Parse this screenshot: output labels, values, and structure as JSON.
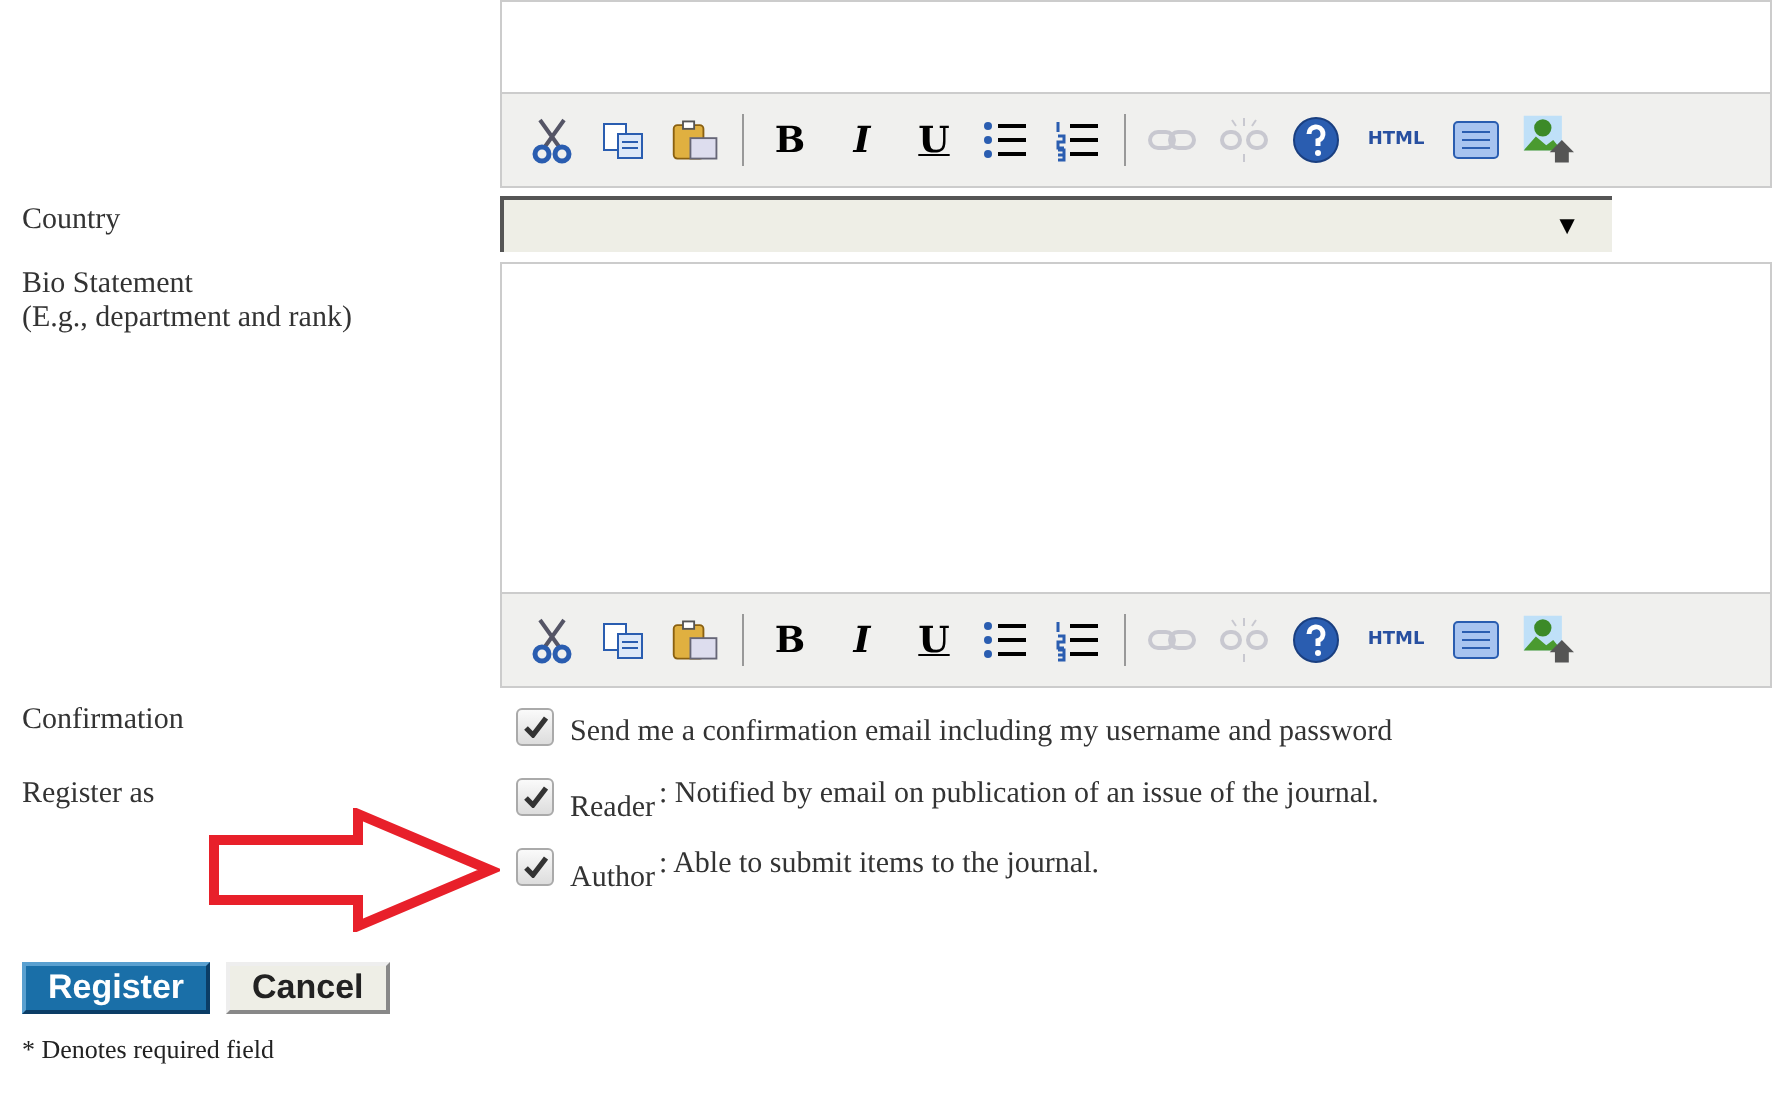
{
  "top_editor": {
    "toolbar": [
      {
        "kind": "cut"
      },
      {
        "kind": "copy"
      },
      {
        "kind": "paste"
      },
      {
        "kind": "separator"
      },
      {
        "kind": "text",
        "label": "B"
      },
      {
        "kind": "text",
        "label": "I"
      },
      {
        "kind": "text",
        "label": "U"
      },
      {
        "kind": "bullets"
      },
      {
        "kind": "numbers"
      },
      {
        "kind": "separator"
      },
      {
        "kind": "link",
        "disabled": true
      },
      {
        "kind": "unlink",
        "disabled": true
      },
      {
        "kind": "help"
      },
      {
        "kind": "text",
        "label": "HTML"
      },
      {
        "kind": "fullscreen"
      },
      {
        "kind": "image"
      }
    ]
  },
  "country": {
    "label": "Country",
    "arrow": "▼"
  },
  "bio": {
    "label": "Bio Statement",
    "hint": "(E.g., department and rank)",
    "toolbar": [
      {
        "kind": "cut"
      },
      {
        "kind": "copy"
      },
      {
        "kind": "paste"
      },
      {
        "kind": "separator"
      },
      {
        "kind": "text",
        "label": "B"
      },
      {
        "kind": "text",
        "label": "I"
      },
      {
        "kind": "text",
        "label": "U"
      },
      {
        "kind": "bullets"
      },
      {
        "kind": "numbers"
      },
      {
        "kind": "separator"
      },
      {
        "kind": "link",
        "disabled": true
      },
      {
        "kind": "unlink",
        "disabled": true
      },
      {
        "kind": "help"
      },
      {
        "kind": "text",
        "label": "HTML"
      },
      {
        "kind": "fullscreen"
      },
      {
        "kind": "image"
      }
    ]
  },
  "confirmation": {
    "label": "Confirmation",
    "checked": true,
    "text": "Send me a confirmation email including my username and password"
  },
  "register_as": {
    "label": "Register as",
    "options": [
      {
        "role": "Reader",
        "checked": true,
        "description": ": Notified by email on publication of an issue of the journal."
      },
      {
        "role": "Author",
        "checked": true,
        "description": ": Able to submit items to the journal."
      }
    ]
  },
  "buttons": [
    {
      "label": "Register",
      "kind": "primary"
    },
    {
      "label": "Cancel",
      "kind": "secondary"
    }
  ],
  "footnote": "* Denotes required field"
}
